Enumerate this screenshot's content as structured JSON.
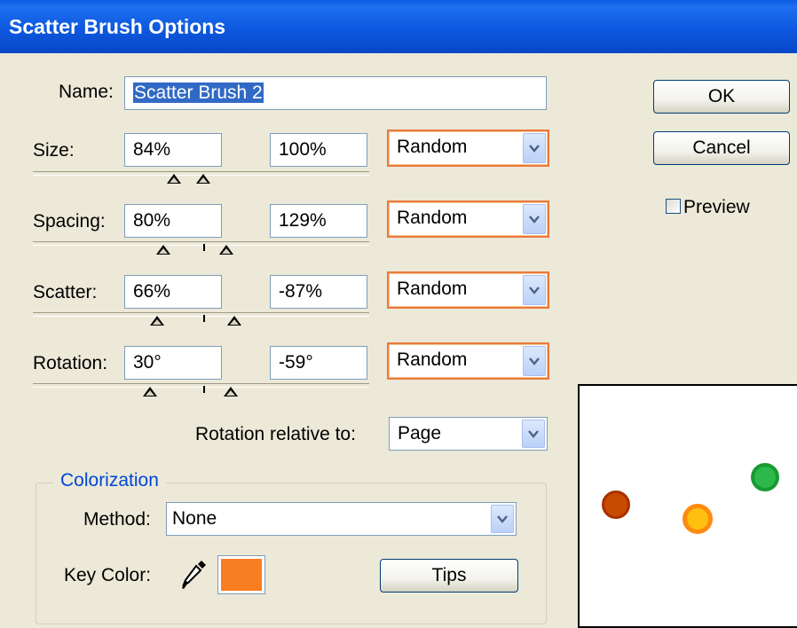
{
  "window": {
    "title": "Scatter Brush Options"
  },
  "name_row": {
    "label": "Name:",
    "value": "Scatter Brush 2"
  },
  "rows": [
    {
      "key": "size",
      "label": "Size:",
      "min": "84%",
      "max": "100%",
      "variation": "Random"
    },
    {
      "key": "spacing",
      "label": "Spacing:",
      "min": "80%",
      "max": "129%",
      "variation": "Random"
    },
    {
      "key": "scatter",
      "label": "Scatter:",
      "min": "66%",
      "max": "-87%",
      "variation": "Random"
    },
    {
      "key": "rotation",
      "label": "Rotation:",
      "min": "30°",
      "max": "-59°",
      "variation": "Random"
    }
  ],
  "rotation_relative": {
    "label": "Rotation relative to:",
    "value": "Page"
  },
  "colorization": {
    "title": "Colorization",
    "method_label": "Method:",
    "method_value": "None",
    "key_color_label": "Key Color:",
    "key_color": "#f97d21",
    "tips_label": "Tips"
  },
  "buttons": {
    "ok": "OK",
    "cancel": "Cancel"
  },
  "preview": {
    "label": "Preview",
    "checked": false
  },
  "icons": {
    "eyedropper": "eyedropper-icon",
    "dropdown": "chevron-down-icon"
  },
  "colors": {
    "title_bar": "#0a5ce2",
    "dialog_bg": "#ece9d8",
    "combo_highlight": "#ea7a3c",
    "group_title": "#0046d5"
  }
}
